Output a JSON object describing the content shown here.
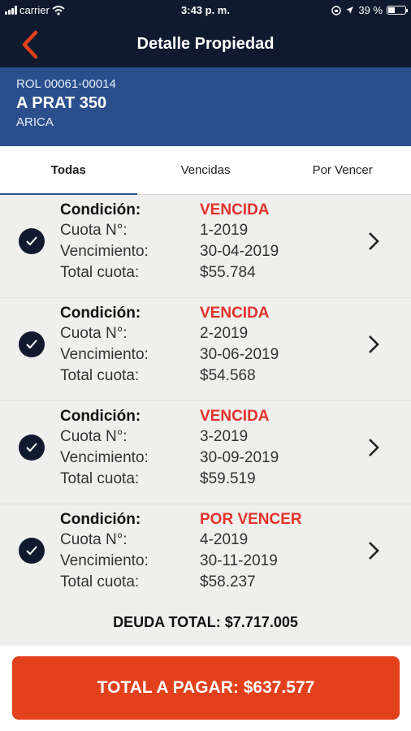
{
  "status_bar": {
    "carrier": "carrier",
    "time": "3:43 p. m.",
    "battery": "39 %",
    "battery_level": 0.39
  },
  "nav": {
    "title": "Detalle Propiedad",
    "back_icon": "chevron-left-icon",
    "accent_color": "#e3401c"
  },
  "property": {
    "rol": "ROL 00061-00014",
    "address": "A PRAT 350",
    "city": "ARICA"
  },
  "tabs": [
    {
      "label": "Todas",
      "active": true
    },
    {
      "label": "Vencidas",
      "active": false
    },
    {
      "label": "Por Vencer",
      "active": false
    }
  ],
  "labels": {
    "condicion": "Condición:",
    "cuota": "Cuota N°:",
    "vencimiento": "Vencimiento:",
    "total": "Total cuota:"
  },
  "installments": [
    {
      "status": "VENCIDA",
      "cuota": "1-2019",
      "vencimiento": "30-04-2019",
      "total": "$55.784",
      "selected": true
    },
    {
      "status": "VENCIDA",
      "cuota": "2-2019",
      "vencimiento": "30-06-2019",
      "total": "$54.568",
      "selected": true
    },
    {
      "status": "VENCIDA",
      "cuota": "3-2019",
      "vencimiento": "30-09-2019",
      "total": "$59.519",
      "selected": true
    },
    {
      "status": "POR VENCER",
      "cuota": "4-2019",
      "vencimiento": "30-11-2019",
      "total": "$58.237",
      "selected": true
    }
  ],
  "totals": {
    "deuda_total": "DEUDA TOTAL: $7.717.005",
    "pay_button": "TOTAL A PAGAR: $637.577"
  }
}
